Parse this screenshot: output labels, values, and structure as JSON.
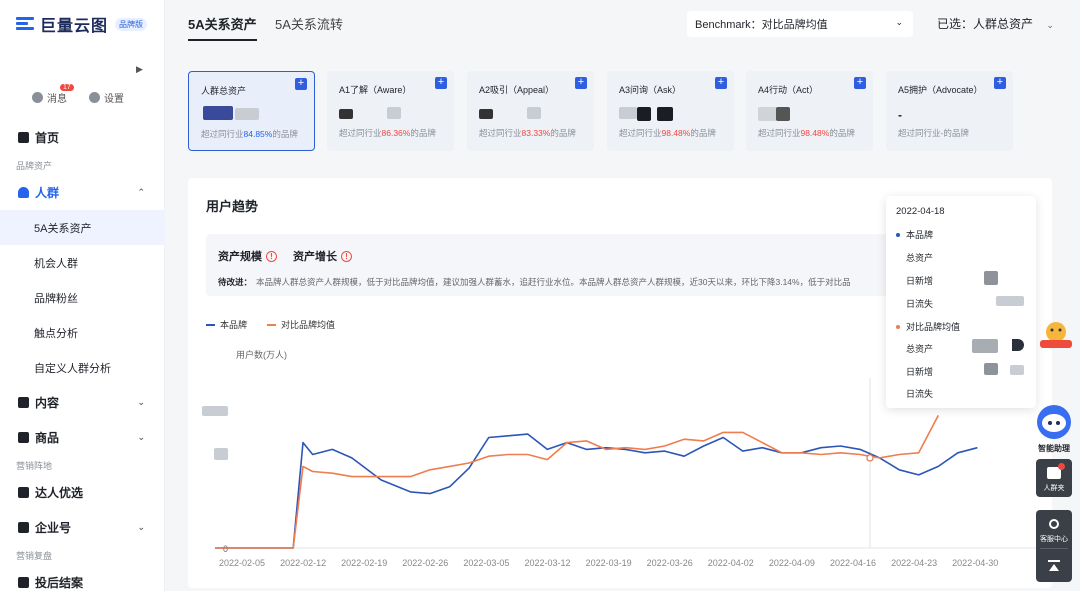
{
  "brand": {
    "logo_text": "巨量云图",
    "badge": "品牌版"
  },
  "top_buttons": {
    "messages": "消息",
    "messages_count": "17",
    "settings": "设置"
  },
  "sidebar": {
    "items": [
      {
        "label": "首页",
        "icon": "home-icon",
        "type": "main"
      },
      {
        "label": "品牌资产",
        "type": "group"
      },
      {
        "label": "人群",
        "icon": "people-icon",
        "type": "main",
        "accent": true,
        "chevron": "up"
      },
      {
        "label": "5A关系资产",
        "type": "sub",
        "active": true
      },
      {
        "label": "机会人群",
        "type": "sub"
      },
      {
        "label": "品牌粉丝",
        "type": "sub"
      },
      {
        "label": "触点分析",
        "type": "sub"
      },
      {
        "label": "自定义人群分析",
        "type": "sub"
      },
      {
        "label": "内容",
        "icon": "content-icon",
        "type": "main",
        "chevron": "down"
      },
      {
        "label": "商品",
        "icon": "shop-icon",
        "type": "main",
        "chevron": "down"
      },
      {
        "label": "营销阵地",
        "type": "group"
      },
      {
        "label": "达人优选",
        "icon": "star-icon",
        "type": "main"
      },
      {
        "label": "企业号",
        "icon": "enterprise-icon",
        "type": "main",
        "chevron": "down"
      },
      {
        "label": "营销复盘",
        "type": "group"
      },
      {
        "label": "投后结案",
        "icon": "report-icon",
        "type": "main"
      }
    ]
  },
  "header": {
    "tabs": [
      {
        "label": "5A关系资产",
        "active": true
      },
      {
        "label": "5A关系流转",
        "active": false
      }
    ],
    "benchmark": "Benchmark：对比品牌均值",
    "selected": "已选：人群总资产"
  },
  "cards": [
    {
      "title": "人群总资产",
      "pre": "超过同行业",
      "pct": "84.85%",
      "post": "的品牌",
      "pct_color": "blue",
      "active": true
    },
    {
      "title": "A1了解（Aware）",
      "pre": "超过同行业",
      "pct": "86.36%",
      "post": "的品牌",
      "pct_color": "red"
    },
    {
      "title": "A2吸引（Appeal）",
      "pre": "超过同行业",
      "pct": "83.33%",
      "post": "的品牌",
      "pct_color": "red"
    },
    {
      "title": "A3问询（Ask）",
      "pre": "超过同行业",
      "pct": "98.48%",
      "post": "的品牌",
      "pct_color": "red"
    },
    {
      "title": "A4行动（Act）",
      "pre": "超过同行业",
      "pct": "98.48%",
      "post": "的品牌",
      "pct_color": "red"
    },
    {
      "title": "A5拥护（Advocate）",
      "value": "-",
      "pre": "超过同行业",
      "pct": "-",
      "post": "的品牌",
      "pct_color": "none"
    }
  ],
  "trend": {
    "title": "用户趋势",
    "insight_tabs": [
      "资产规模",
      "资产增长"
    ],
    "insight_label": "待改进：",
    "insight_text": "本品牌人群总资产人群规模，低于对比品牌均值，建议加强人群蓄水，追赶行业水位。本品牌人群总资产人群规模，近30天以来，环比下降3.14%，低于对比品"
  },
  "tooltip": {
    "date": "2022-04-18",
    "series_a": "本品牌",
    "series_b": "对比品牌均值",
    "row_total": "总资产",
    "row_new": "日新增",
    "row_lost": "日流失"
  },
  "colors": {
    "series_a": "#2b55b8",
    "series_b": "#ee7d4f",
    "accent": "#2563eb"
  },
  "widgets": {
    "assistant": "智能助理",
    "crowd_pack": "人群夹",
    "service": "客服中心"
  },
  "chart_data": {
    "type": "line",
    "ylabel": "用户数(万人)",
    "y_ticks": [
      "0"
    ],
    "x_ticks": [
      "2022-02-05",
      "2022-02-12",
      "2022-02-19",
      "2022-02-26",
      "2022-03-05",
      "2022-03-12",
      "2022-03-19",
      "2022-03-26",
      "2022-04-02",
      "2022-04-09",
      "2022-04-16",
      "2022-04-23",
      "2022-04-30"
    ],
    "series": [
      {
        "name": "本品牌",
        "color": "#2b55b8",
        "points": [
          [
            0,
            0
          ],
          [
            6,
            0
          ],
          [
            8,
            0
          ],
          [
            9,
            62
          ],
          [
            10,
            55
          ],
          [
            12,
            58
          ],
          [
            14,
            53
          ],
          [
            17,
            40
          ],
          [
            20,
            33
          ],
          [
            22,
            32
          ],
          [
            24,
            36
          ],
          [
            26,
            47
          ],
          [
            28,
            65
          ],
          [
            30,
            66
          ],
          [
            32,
            67
          ],
          [
            34,
            58
          ],
          [
            36,
            62
          ],
          [
            38,
            58
          ],
          [
            40,
            59
          ],
          [
            42,
            58
          ],
          [
            44,
            56
          ],
          [
            46,
            57
          ],
          [
            48,
            54
          ],
          [
            50,
            60
          ],
          [
            52,
            65
          ],
          [
            54,
            57
          ],
          [
            56,
            59
          ],
          [
            58,
            56
          ],
          [
            60,
            56
          ],
          [
            62,
            59
          ],
          [
            64,
            60
          ],
          [
            66,
            58
          ],
          [
            68,
            53
          ],
          [
            70,
            46
          ],
          [
            72,
            43
          ],
          [
            74,
            48
          ],
          [
            76,
            56
          ],
          [
            78,
            59
          ]
        ]
      },
      {
        "name": "对比品牌均值",
        "color": "#ee7d4f",
        "points": [
          [
            0,
            0
          ],
          [
            6,
            0
          ],
          [
            8,
            0
          ],
          [
            9,
            48
          ],
          [
            10,
            45
          ],
          [
            12,
            44
          ],
          [
            14,
            42
          ],
          [
            16,
            42
          ],
          [
            18,
            42
          ],
          [
            20,
            42
          ],
          [
            22,
            46
          ],
          [
            24,
            48
          ],
          [
            26,
            50
          ],
          [
            28,
            54
          ],
          [
            30,
            55
          ],
          [
            32,
            55
          ],
          [
            34,
            52
          ],
          [
            36,
            62
          ],
          [
            38,
            63
          ],
          [
            40,
            58
          ],
          [
            42,
            59
          ],
          [
            44,
            58
          ],
          [
            46,
            60
          ],
          [
            48,
            64
          ],
          [
            50,
            63
          ],
          [
            52,
            68
          ],
          [
            54,
            68
          ],
          [
            56,
            62
          ],
          [
            58,
            56
          ],
          [
            60,
            56
          ],
          [
            62,
            55
          ],
          [
            64,
            56
          ],
          [
            66,
            55
          ],
          [
            68,
            53
          ],
          [
            70,
            55
          ],
          [
            72,
            56
          ],
          [
            74,
            78
          ]
        ]
      }
    ]
  }
}
